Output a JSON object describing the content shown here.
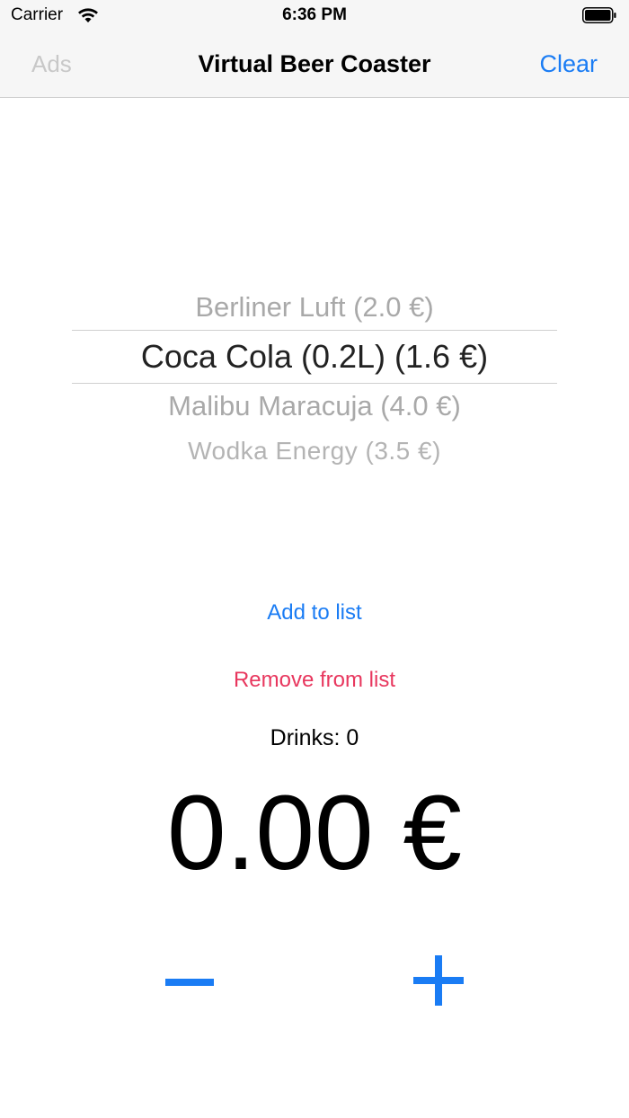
{
  "status_bar": {
    "carrier": "Carrier",
    "time": "6:36 PM",
    "wifi_icon": "wifi-icon",
    "battery_icon": "battery-full-icon"
  },
  "nav": {
    "left_label": "Ads",
    "title": "Virtual Beer Coaster",
    "right_label": "Clear"
  },
  "picker": {
    "items": [
      "Berliner Luft (2.0 €)",
      "Coca Cola (0.2L) (1.6 €)",
      "Malibu Maracuja (4.0 €)",
      "Wodka Energy (3.5 €)"
    ],
    "selected_index": 1
  },
  "actions": {
    "add_label": "Add to list",
    "remove_label": "Remove from list"
  },
  "summary": {
    "drinks_text": "Drinks: 0",
    "total_text": "0.00 €"
  },
  "steppers": {
    "minus_icon": "minus-icon",
    "plus_icon": "plus-icon"
  },
  "colors": {
    "accent": "#1a7cf4",
    "destructive": "#e8375e",
    "disabled": "#c8c8c8"
  }
}
